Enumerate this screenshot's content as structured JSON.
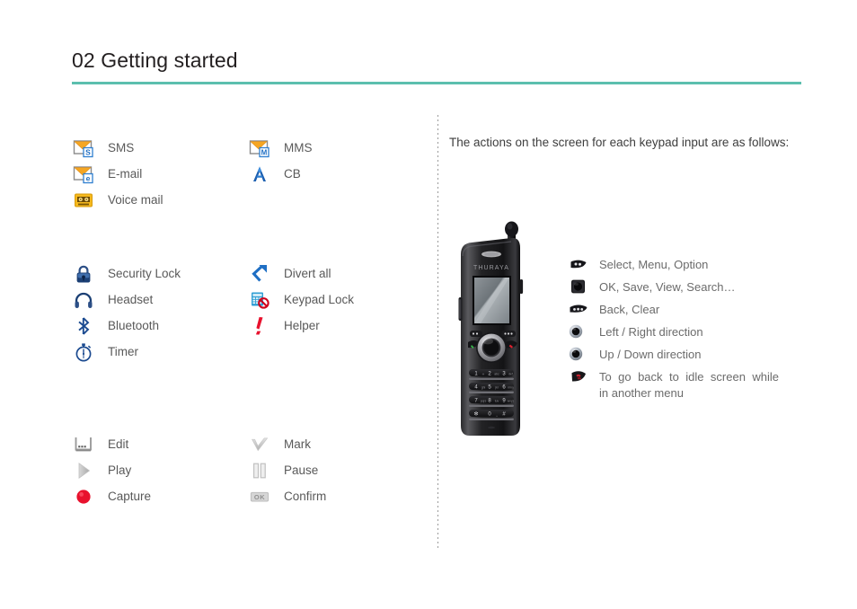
{
  "header": {
    "title": "02 Getting started",
    "rule_color": "#5cbfae"
  },
  "left_panel": {
    "groups": [
      {
        "name": "messaging-icons",
        "column_a": [
          {
            "icon": "sms-envelope-icon",
            "label": "SMS"
          },
          {
            "icon": "email-envelope-icon",
            "label": "E-mail"
          },
          {
            "icon": "voice-mail-cassette-icon",
            "label": "Voice mail"
          }
        ],
        "column_b": [
          {
            "icon": "mms-envelope-icon",
            "label": "MMS"
          },
          {
            "icon": "cb-antenna-icon",
            "label": "CB"
          }
        ]
      },
      {
        "name": "status-icons",
        "column_a": [
          {
            "icon": "padlock-icon",
            "label": "Security Lock"
          },
          {
            "icon": "headset-icon",
            "label": "Headset"
          },
          {
            "icon": "bluetooth-icon",
            "label": "Bluetooth"
          },
          {
            "icon": "stopwatch-timer-icon",
            "label": "Timer"
          }
        ],
        "column_b": [
          {
            "icon": "divert-arrow-icon",
            "label": "Divert all"
          },
          {
            "icon": "keypad-lock-icon",
            "label": "Keypad Lock"
          },
          {
            "icon": "helper-exclamation-icon",
            "label": "Helper"
          }
        ]
      },
      {
        "name": "media-icons",
        "column_a": [
          {
            "icon": "edit-pencil-box-icon",
            "label": "Edit"
          },
          {
            "icon": "play-triangle-icon",
            "label": "Play"
          },
          {
            "icon": "capture-record-icon",
            "label": "Capture"
          }
        ],
        "column_b": [
          {
            "icon": "mark-check-icon",
            "label": "Mark"
          },
          {
            "icon": "pause-bars-icon",
            "label": "Pause"
          },
          {
            "icon": "confirm-ok-icon",
            "label": "Confirm"
          }
        ]
      }
    ]
  },
  "right_panel": {
    "intro": "The actions on the screen for each keypad input are as follows:",
    "phone": {
      "brand": "THURAYA",
      "keypad": [
        [
          "1",
          "2",
          "3"
        ],
        [
          "4",
          "5",
          "6"
        ],
        [
          "7",
          "8",
          "9"
        ],
        [
          "*",
          "0",
          "#"
        ]
      ]
    },
    "keys": [
      {
        "icon": "soft-key-left-icon",
        "label": "Select, Menu, Option"
      },
      {
        "icon": "center-ok-key-icon",
        "label": "OK, Save, View, Search…"
      },
      {
        "icon": "soft-key-right-icon",
        "label": "Back, Clear"
      },
      {
        "icon": "navigation-left-right-icon",
        "label": "Left / Right direction"
      },
      {
        "icon": "navigation-up-down-icon",
        "label": "Up / Down direction"
      },
      {
        "icon": "end-call-key-icon",
        "label": "To go back to idle screen while in another menu",
        "line1": "To go back to idle screen while",
        "line2": "in another menu"
      }
    ]
  }
}
